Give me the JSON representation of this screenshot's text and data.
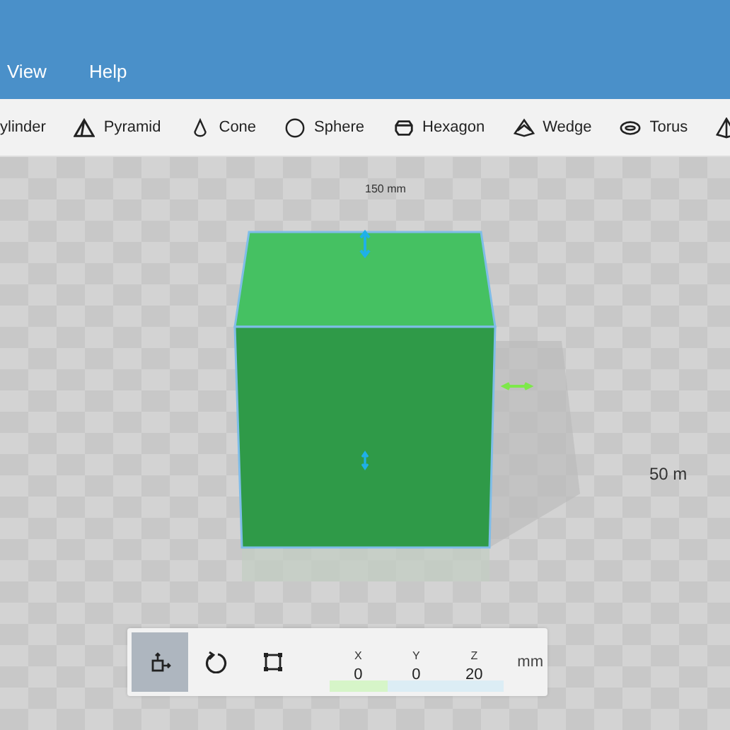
{
  "menu": [
    {
      "label": "View"
    },
    {
      "label": "Help"
    }
  ],
  "shapes": [
    {
      "label": "ylinder",
      "kind": "none"
    },
    {
      "label": "Pyramid",
      "kind": "pyramid"
    },
    {
      "label": "Cone",
      "kind": "cone"
    },
    {
      "label": "Sphere",
      "kind": "sphere"
    },
    {
      "label": "Hexagon",
      "kind": "hexagon"
    },
    {
      "label": "Wedge",
      "kind": "wedge"
    },
    {
      "label": "Torus",
      "kind": "torus"
    },
    {
      "kind": "tetra"
    }
  ],
  "viewport": {
    "top_label": "150 mm",
    "side_label": "50 m"
  },
  "transform": {
    "tools": [
      {
        "kind": "move",
        "selected": true
      },
      {
        "kind": "rotate",
        "selected": false
      },
      {
        "kind": "scale",
        "selected": false
      }
    ],
    "fields": [
      {
        "axis": "X",
        "value": "0",
        "color": "#d6f5c8"
      },
      {
        "axis": "Y",
        "value": "0",
        "color": "#dcedf5"
      },
      {
        "axis": "Z",
        "value": "20",
        "color": "#dcedf5"
      }
    ],
    "unit": "mm"
  }
}
